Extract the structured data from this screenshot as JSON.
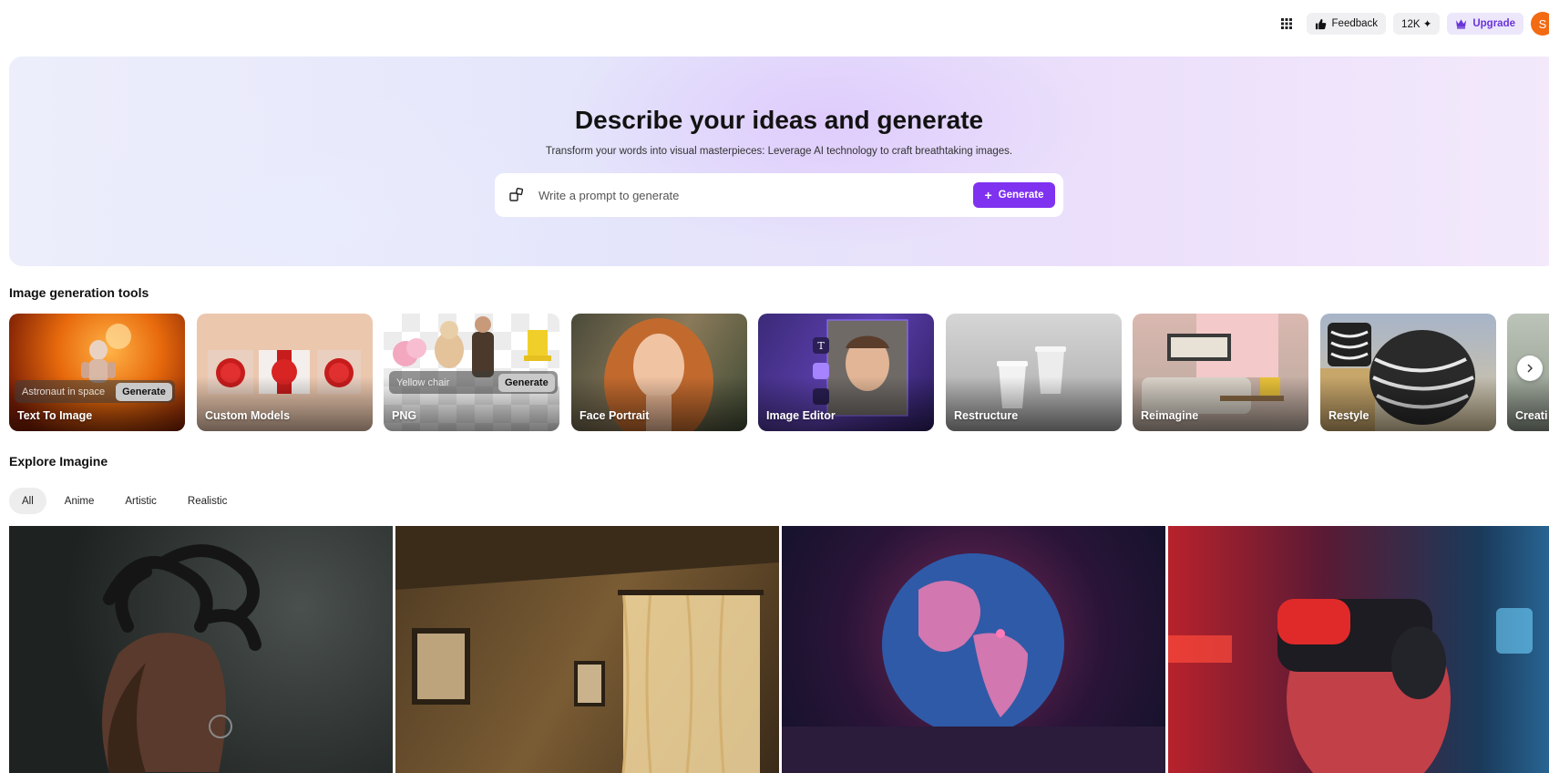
{
  "topbar": {
    "feedback_label": "Feedback",
    "credits_label": "12K ✦",
    "upgrade_label": "Upgrade",
    "avatar_initial": "S"
  },
  "hero": {
    "title": "Describe your ideas and generate",
    "subtitle": "Transform your words into visual masterpieces: Leverage AI technology to craft breathtaking images.",
    "prompt_placeholder": "Write a prompt to generate",
    "generate_label": "Generate"
  },
  "tools": {
    "section_title": "Image generation tools",
    "items": [
      {
        "label": "Text To Image",
        "mini_prompt": "Astronaut in space",
        "mini_button": "Generate"
      },
      {
        "label": "Custom Models"
      },
      {
        "label": "PNG",
        "mini_prompt": "Yellow chair",
        "mini_button": "Generate"
      },
      {
        "label": "Face Portrait"
      },
      {
        "label": "Image Editor"
      },
      {
        "label": "Restructure"
      },
      {
        "label": "Reimagine"
      },
      {
        "label": "Restyle"
      },
      {
        "label": "Creati"
      }
    ]
  },
  "explore": {
    "section_title": "Explore Imagine",
    "tabs": [
      "All",
      "Anime",
      "Artistic",
      "Realistic"
    ]
  },
  "colors": {
    "accent": "#7f32f0",
    "avatar": "#f26a12",
    "upgrade_text": "#6a35d8"
  }
}
